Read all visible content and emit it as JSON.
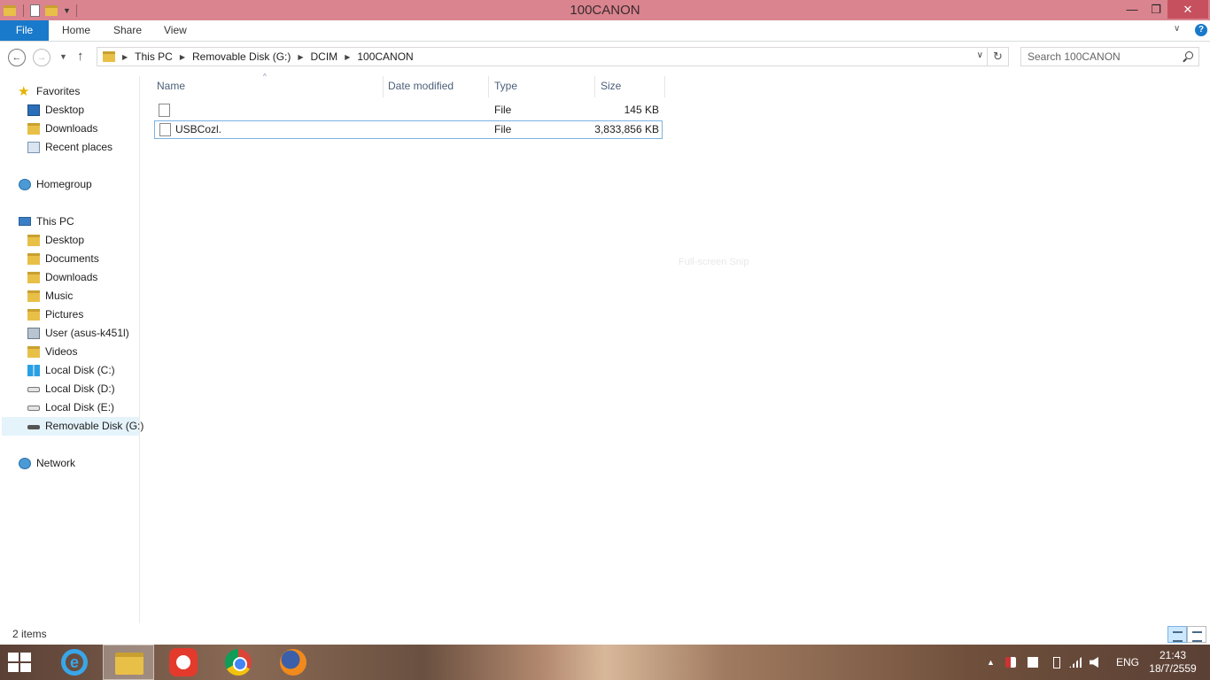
{
  "window": {
    "title": "100CANON",
    "min_glyph": "—",
    "max_glyph": "❐",
    "close_glyph": "✕"
  },
  "ribbon": {
    "tabs": [
      "File",
      "Home",
      "Share",
      "View"
    ],
    "help_glyph": "?"
  },
  "navigation": {
    "back_glyph": "←",
    "forward_glyph": "→",
    "up_glyph": "↑",
    "breadcrumb": [
      "This PC",
      "Removable Disk (G:)",
      "DCIM",
      "100CANON"
    ],
    "refresh_glyph": "↻",
    "search_placeholder": "Search 100CANON"
  },
  "sidebar": {
    "favorites": {
      "label": "Favorites",
      "items": [
        "Desktop",
        "Downloads",
        "Recent places"
      ]
    },
    "homegroup": "Homegroup",
    "this_pc": {
      "label": "This PC",
      "items": [
        "Desktop",
        "Documents",
        "Downloads",
        "Music",
        "Pictures",
        "User (asus-k451l)",
        "Videos",
        "Local Disk (C:)",
        "Local Disk (D:)",
        "Local Disk (E:)",
        "Removable Disk (G:)"
      ]
    },
    "network": "Network",
    "selected": "Removable Disk (G:)"
  },
  "filelist": {
    "columns": [
      "Name",
      "Date modified",
      "Type",
      "Size"
    ],
    "sort_arrow": "^",
    "rows": [
      {
        "name": "",
        "date_modified": "",
        "type": "File",
        "size": "145 KB"
      },
      {
        "name": "USBCozl.",
        "date_modified": "",
        "type": "File",
        "size": "3,833,856 KB"
      }
    ],
    "ghost_tooltip": "Full-screen Snip"
  },
  "status": {
    "count": "2 items"
  },
  "taskbar": {
    "ie_glyph": "e",
    "tray_chevron": "▲",
    "language": "ENG",
    "time": "21:43",
    "date": "18/7/2559"
  }
}
